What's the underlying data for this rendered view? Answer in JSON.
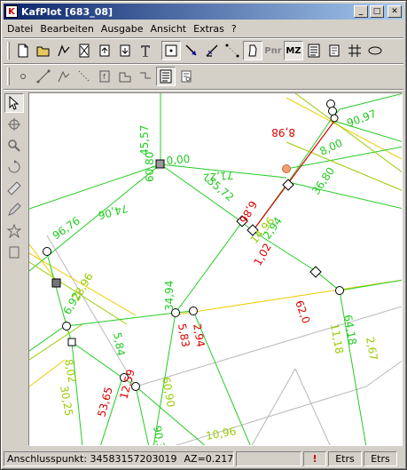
{
  "window": {
    "title": "KafPlot [683_08]"
  },
  "menu": [
    "Datei",
    "Bearbeiten",
    "Ausgabe",
    "Ansicht",
    "Extras",
    "?"
  ],
  "toolbar_text": {
    "pnr": "Pnr",
    "mz": "MZ"
  },
  "map": {
    "labels": [
      "45,57",
      "0,00",
      "71,22",
      "55,72",
      "60,80",
      "74,06",
      "96,76",
      "8,00",
      "34,94",
      "36,80",
      "90,97",
      "8,98",
      "6,92",
      "28,96",
      "1,02",
      "6,86",
      "5,83",
      "2,94",
      "11,18",
      "62,0",
      "64,18",
      "2,67",
      "14,96",
      "2,94",
      "53,65",
      "12,59",
      "8,02",
      "60,90",
      "5,84",
      "30,25",
      "90,3",
      "10,96"
    ]
  },
  "status": {
    "anschlusspunkt": "Anschlusspunkt: 34583157203019",
    "az": "AZ=0.217",
    "alert": "!",
    "etrs1": "Etrs",
    "etrs2": "Etrs"
  },
  "colors": {
    "green": "#22cc22",
    "lime": "#99cc00",
    "red": "#dd0000",
    "yellow": "#eecc00",
    "grey": "#b0b0b0"
  }
}
